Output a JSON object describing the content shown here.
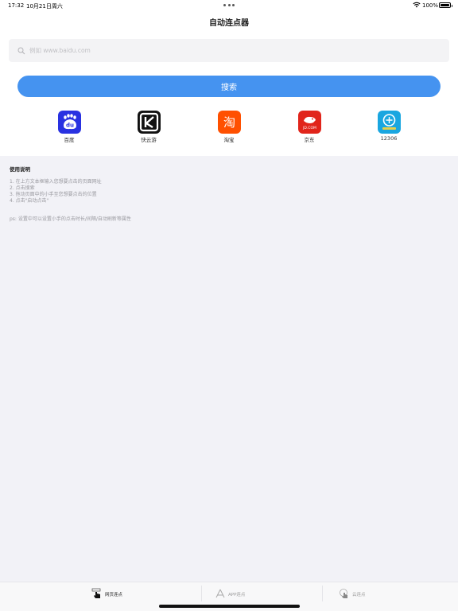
{
  "status_bar": {
    "time": "17:32",
    "date": "10月21日周六",
    "battery": "100%"
  },
  "nav": {
    "title": "自动连点器"
  },
  "search": {
    "placeholder": "例如 www.baidu.com",
    "value": "",
    "button_label": "搜索"
  },
  "shortcuts": [
    {
      "label": "百度",
      "icon": "baidu-icon",
      "color": "#2932e1"
    },
    {
      "label": "快云游",
      "icon": "kuaiyun-icon",
      "color": "#111111"
    },
    {
      "label": "淘宝",
      "icon": "taobao-icon",
      "color": "#ff5000"
    },
    {
      "label": "京东",
      "icon": "jd-icon",
      "color": "#e1251b"
    },
    {
      "label": "12306",
      "icon": "railway-12306-icon",
      "color": "#19a6e0"
    }
  ],
  "instructions": {
    "heading": "使用说明",
    "steps": [
      "1. 在上方文本框输入您想要点击的页面网址",
      "2. 点击搜索",
      "3. 拖动页面中的小手至您想要点击的位置",
      "4. 点击\"启动点击\""
    ],
    "ps": "ps: 设置中可以设置小手的点击时长/间隔/自动刷新等属性"
  },
  "tab_bar": {
    "tabs": [
      {
        "label": "网页连点",
        "icon": "hand-tap-icon",
        "active": true
      },
      {
        "label": "APP连点",
        "icon": "app-store-icon",
        "active": false
      },
      {
        "label": "云连点",
        "icon": "cloud-tap-icon",
        "active": false
      }
    ]
  },
  "colors": {
    "accent": "#4593f0",
    "background": "#f2f2f7"
  }
}
